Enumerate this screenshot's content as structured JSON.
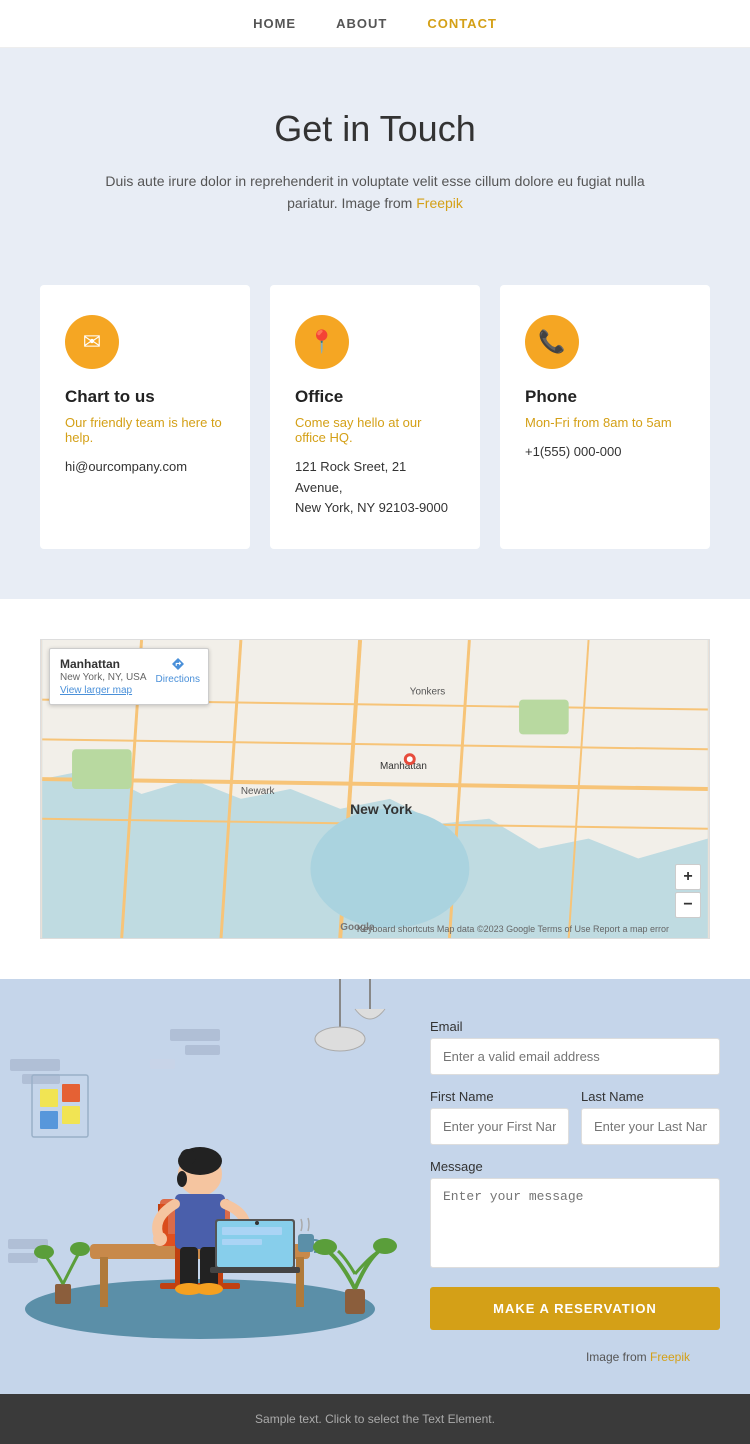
{
  "nav": {
    "home": "HOME",
    "about": "ABOUT",
    "contact": "CONTACT"
  },
  "hero": {
    "title": "Get in Touch",
    "description": "Duis aute irure dolor in reprehenderit in voluptate velit esse cillum dolore eu fugiat nulla pariatur. Image from",
    "freepik_link": "Freepik"
  },
  "cards": [
    {
      "icon": "✉",
      "title": "Chart to us",
      "subtitle": "Our friendly team is here to help.",
      "detail": "hi@ourcompany.com",
      "extra": ""
    },
    {
      "icon": "📍",
      "title": "Office",
      "subtitle": "Come say hello at our office HQ.",
      "detail": "121 Rock Sreet, 21 Avenue,\nNew York, NY 92103-9000",
      "extra": ""
    },
    {
      "icon": "📞",
      "title": "Phone",
      "subtitle": "Mon-Fri from 8am to 5am",
      "detail": "+1(555) 000-000",
      "extra": ""
    }
  ],
  "map": {
    "location": "Manhattan",
    "sublocation": "New York, NY, USA",
    "directions": "Directions",
    "view_map": "View larger map",
    "zoom_in": "+",
    "zoom_out": "−",
    "credits": "Keyboard shortcuts  Map data ©2023 Google  Terms of Use  Report a map error",
    "google": "Google"
  },
  "form": {
    "email_label": "Email",
    "email_placeholder": "Enter a valid email address",
    "firstname_label": "First Name",
    "firstname_placeholder": "Enter your First Name",
    "lastname_label": "Last Name",
    "lastname_placeholder": "Enter your Last Name",
    "message_label": "Message",
    "message_placeholder": "Enter your message",
    "submit_label": "MAKE A RESERVATION",
    "image_from": "Image from",
    "freepik_link": "Freepik"
  },
  "footer": {
    "text": "Sample text. Click to select the Text Element."
  }
}
